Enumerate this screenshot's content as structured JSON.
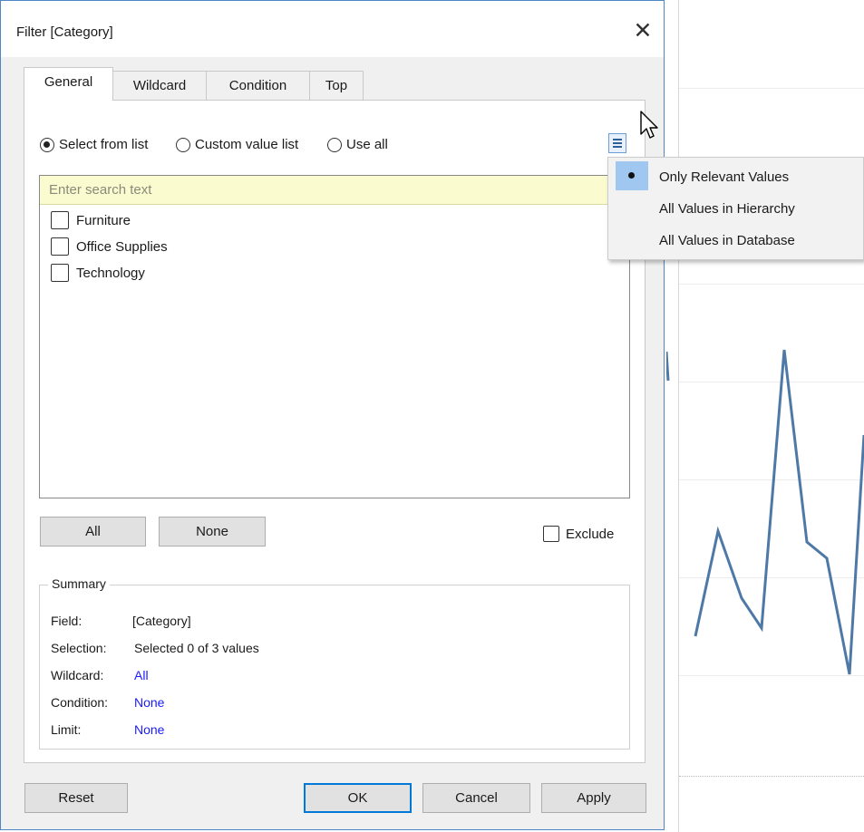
{
  "dialog": {
    "title": "Filter [Category]",
    "close_glyph": "✕"
  },
  "tabs": [
    {
      "label": "General",
      "active": true
    },
    {
      "label": "Wildcard",
      "active": false
    },
    {
      "label": "Condition",
      "active": false
    },
    {
      "label": "Top",
      "active": false
    }
  ],
  "radios": [
    {
      "label": "Select from list",
      "checked": true
    },
    {
      "label": "Custom value list",
      "checked": false
    },
    {
      "label": "Use all",
      "checked": false
    }
  ],
  "search": {
    "placeholder": "Enter search text",
    "value": ""
  },
  "list_items": [
    {
      "label": "Furniture",
      "checked": false
    },
    {
      "label": "Office Supplies",
      "checked": false
    },
    {
      "label": "Technology",
      "checked": false
    }
  ],
  "list_buttons": {
    "all": "All",
    "none": "None"
  },
  "exclude": {
    "label": "Exclude",
    "checked": false
  },
  "summary": {
    "legend": "Summary",
    "rows": [
      {
        "key": "Field:",
        "value": "[Category]",
        "highlight": false
      },
      {
        "key": "Selection:",
        "value": "Selected 0 of 3 values",
        "highlight": false
      },
      {
        "key": "Wildcard:",
        "value": "All",
        "highlight": true
      },
      {
        "key": "Condition:",
        "value": "None",
        "highlight": true
      },
      {
        "key": "Limit:",
        "value": "None",
        "highlight": true
      }
    ]
  },
  "footer": {
    "reset": "Reset",
    "ok": "OK",
    "cancel": "Cancel",
    "apply": "Apply"
  },
  "dropdown_menu": {
    "items": [
      {
        "label": "Only Relevant Values",
        "selected": true
      },
      {
        "label": "All Values in Hierarchy",
        "selected": false
      },
      {
        "label": "All Values in Database",
        "selected": false
      }
    ]
  },
  "colors": {
    "line": "#4e79a7",
    "highlight_text": "#1a1aff",
    "menu_selection": "#9fc7f0",
    "search_bg": "#fbfbd0"
  },
  "icons": {
    "options_menu": "menu-lines-icon",
    "cursor": "arrow-cursor-icon"
  }
}
